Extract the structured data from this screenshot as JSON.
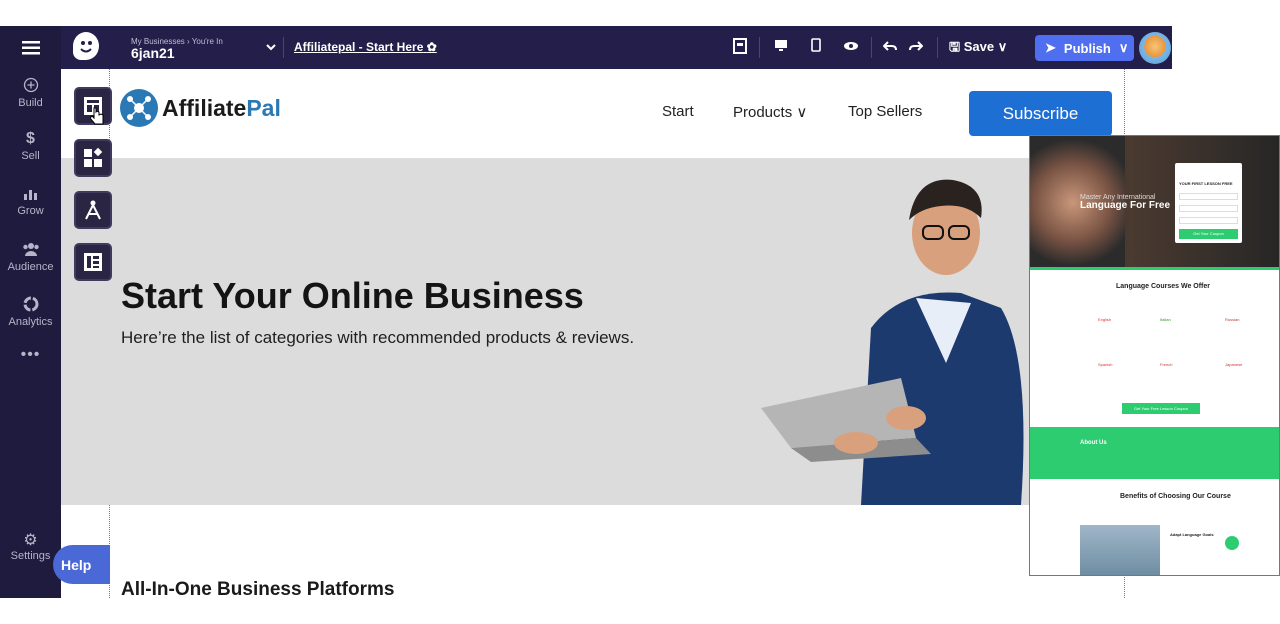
{
  "topbar": {
    "breadcrumb": "My Businesses › You're In",
    "business_name": "6jan21",
    "page_name": "Affiliatepal - Start Here",
    "save_label": "Save",
    "publish_label": "Publish"
  },
  "rail": {
    "items": [
      {
        "label": "Build",
        "icon": "plus-circle-icon"
      },
      {
        "label": "Sell",
        "icon": "dollar-icon"
      },
      {
        "label": "Grow",
        "icon": "chart-icon"
      },
      {
        "label": "Audience",
        "icon": "people-icon"
      },
      {
        "label": "Analytics",
        "icon": "analytics-icon"
      }
    ],
    "more": "•••",
    "settings_label": "Settings"
  },
  "site": {
    "brand_word1": "Affiliate",
    "brand_word2": "Pal",
    "nav": {
      "start": "Start",
      "products": "Products ∨",
      "top_sellers": "Top Sellers"
    },
    "subscribe_label": "Subscribe",
    "hero_title": "Start Your Online Business",
    "hero_subtitle": "Here’re the list of categories with recommended products & reviews.",
    "section_title": "All-In-One Business Platforms"
  },
  "help_label": "Help",
  "preview": {
    "hero_line1": "Master Any International",
    "hero_line2": "Language For Free",
    "form_title": "YOUR FIRST LESSON FREE",
    "form_button": "Get Your Coupon",
    "courses_title": "Language Courses We Offer",
    "languages": [
      "English",
      "Italian",
      "Russian",
      "Spanish",
      "French",
      "Japanese"
    ],
    "courses_button": "Get Your Free Lesson Coupon",
    "about_title": "About Us",
    "benefits_title": "Benefits of Choosing Our Course",
    "benefit_item": "Adapt Language Goals"
  },
  "colors": {
    "rail": "#1f1b3e",
    "topbar": "#241f4a",
    "publish": "#4f6ff0",
    "subscribe": "#1e6fd4",
    "brand_blue": "#2a78b4",
    "preview_green": "#2ecc71"
  }
}
